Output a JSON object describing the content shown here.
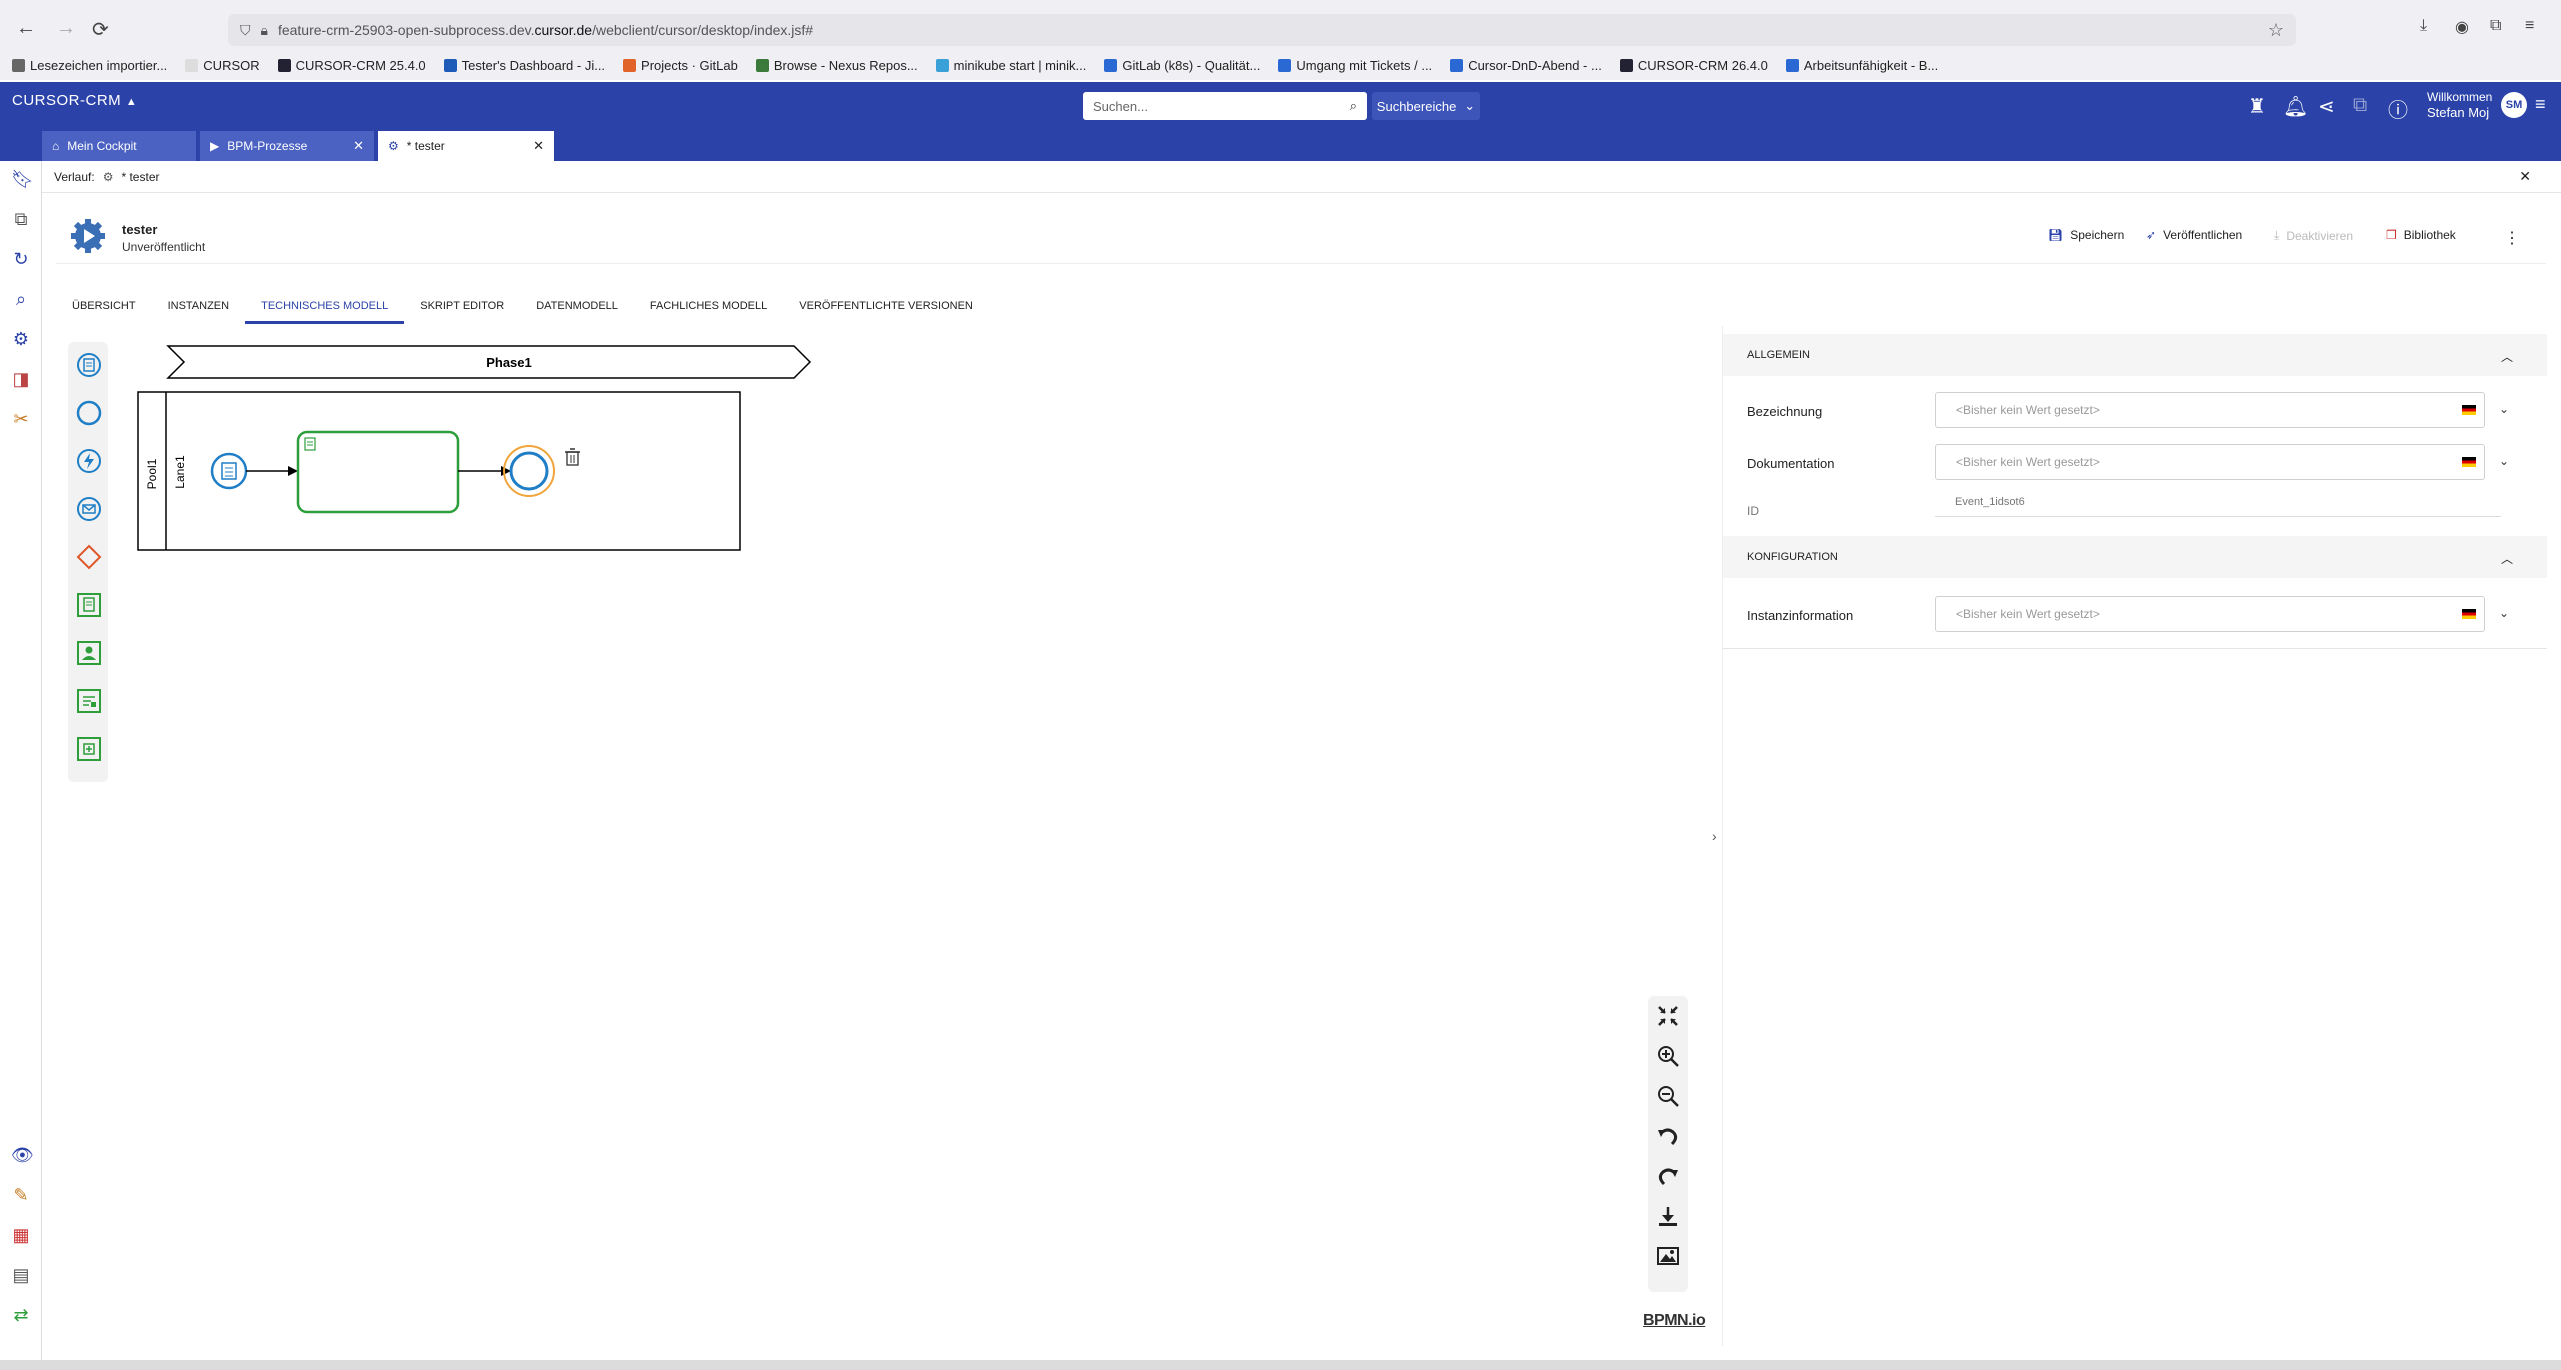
{
  "browser": {
    "url_prefix": "feature-crm-25903-open-subprocess.dev.",
    "url_domain": "cursor.de",
    "url_path": "/webclient/cursor/desktop/index.jsf#",
    "bookmarks": [
      "Lesezeichen importier...",
      "CURSOR",
      "CURSOR-CRM 25.4.0",
      "Tester's Dashboard - Ji...",
      "Projects · GitLab",
      "Browse - Nexus Repos...",
      "minikube start | minik...",
      "GitLab (k8s) - Qualität...",
      "Umgang mit Tickets / ...",
      "Cursor-DnD-Abend - ...",
      "CURSOR-CRM 26.4.0",
      "Arbeitsunfähigkeit - B..."
    ]
  },
  "header": {
    "brand": "CURSOR-CRM",
    "search_placeholder": "Suchen...",
    "search_scope": "Suchbereiche",
    "welcome_line1": "Willkommen",
    "welcome_line2": "Stefan Moj",
    "avatar": "SM"
  },
  "tabs": [
    {
      "label": "Mein Cockpit"
    },
    {
      "label": "BPM-Prozesse"
    },
    {
      "label": "* tester"
    }
  ],
  "history": {
    "label": "Verlauf:",
    "item": "* tester"
  },
  "process": {
    "title": "tester",
    "status": "Unveröffentlicht",
    "actions": {
      "save": "Speichern",
      "publish": "Veröffentlichen",
      "deactivate": "Deaktivieren",
      "library": "Bibliothek"
    }
  },
  "subtabs": [
    "ÜBERSICHT",
    "INSTANZEN",
    "TECHNISCHES MODELL",
    "SKRIPT EDITOR",
    "DATENMODELL",
    "FACHLICHES MODELL",
    "VERÖFFENTLICHTE VERSIONEN"
  ],
  "diagram": {
    "phase": "Phase1",
    "pool": "Pool1",
    "lane": "Lane1",
    "logo": "BPMN.io"
  },
  "properties": {
    "section_general": "ALLGEMEIN",
    "section_config": "KONFIGURATION",
    "label_name": "Bezeichnung",
    "label_doc": "Dokumentation",
    "label_id": "ID",
    "label_instance": "Instanzinformation",
    "placeholder": "<Bisher kein Wert gesetzt>",
    "id_value": "Event_1idsot6"
  },
  "colors": {
    "brand": "#2b43a8",
    "event_blue": "#1f7ec6",
    "task_green": "#2e9e3b",
    "gateway_red": "#e0572b",
    "end_orange": "#f0a43a"
  }
}
